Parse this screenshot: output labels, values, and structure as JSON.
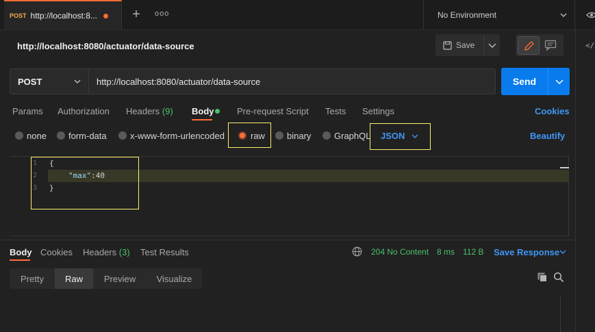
{
  "tab": {
    "method": "POST",
    "title": "http://localhost:8..."
  },
  "environment": {
    "label": "No Environment"
  },
  "request": {
    "title": "http://localhost:8080/actuator/data-source",
    "method": "POST",
    "url": "http://localhost:8080/actuator/data-source",
    "save_label": "Save",
    "send_label": "Send"
  },
  "request_tabs": [
    {
      "label": "Params"
    },
    {
      "label": "Authorization"
    },
    {
      "label": "Headers",
      "count": "(9)"
    },
    {
      "label": "Body"
    },
    {
      "label": "Pre-request Script"
    },
    {
      "label": "Tests"
    },
    {
      "label": "Settings"
    }
  ],
  "cookies_label": "Cookies",
  "body_types": [
    {
      "label": "none"
    },
    {
      "label": "form-data"
    },
    {
      "label": "x-www-form-urlencoded"
    },
    {
      "label": "raw",
      "selected": true
    },
    {
      "label": "binary"
    },
    {
      "label": "GraphQL"
    }
  ],
  "body_format": "JSON",
  "beautify_label": "Beautify",
  "editor": {
    "line_numbers": [
      "1",
      "2",
      "3"
    ],
    "open_brace": "{",
    "key": "\"max\"",
    "colon": ":",
    "value": "40",
    "close_brace": "}"
  },
  "response": {
    "tabs": [
      {
        "label": "Body"
      },
      {
        "label": "Cookies"
      },
      {
        "label": "Headers",
        "count": "(3)"
      },
      {
        "label": "Test Results"
      }
    ],
    "status": "204 No Content",
    "time": "8 ms",
    "size": "112 B",
    "save_label": "Save Response",
    "formats": [
      {
        "label": "Pretty"
      },
      {
        "label": "Raw",
        "active": true
      },
      {
        "label": "Preview"
      },
      {
        "label": "Visualize"
      }
    ]
  },
  "colors": {
    "accent": "#ff6c37",
    "link": "#3f97f4",
    "success": "#4ac26b",
    "send": "#097bed",
    "highlight_box": "#fff06e"
  }
}
